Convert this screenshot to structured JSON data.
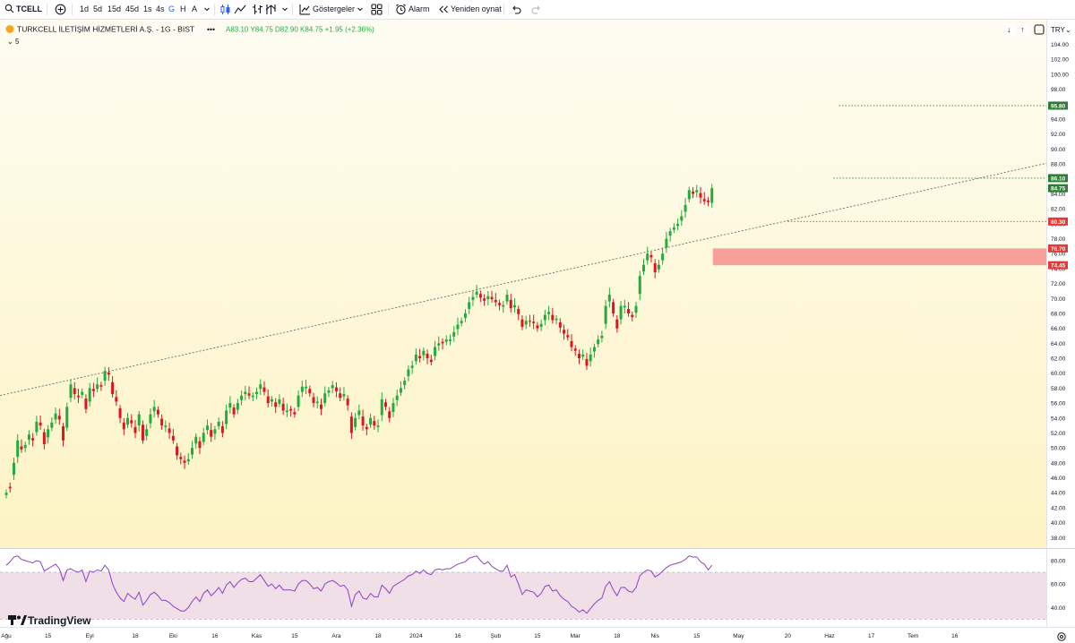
{
  "toolbar": {
    "symbol": "TCELL",
    "intervals": [
      "1d",
      "5d",
      "15d",
      "45d",
      "1s",
      "4s",
      "G",
      "H",
      "A"
    ],
    "active_interval": "G",
    "indicators_label": "Göstergeler",
    "alarm_label": "Alarm",
    "replay_label": "Yeniden oynat"
  },
  "legend": {
    "title": "TURKCELL İLETİŞİM HİZMETLERİ A.Ş. - 1G - BIST",
    "ohlc": "A83.10 Y84.75 D82.90 K84.75 +1.95 (+2.36%)",
    "indicator_count": "5",
    "currency": "TRY"
  },
  "brand": "TradingView",
  "colors": {
    "up": "#22ab3f",
    "down": "#e0141e",
    "bg_top": "#fefcf2",
    "bg_bottom": "#fdf3c4",
    "rsi_line": "#8e3fc6",
    "rsi_band": "#f1dfe8",
    "zone": "#f7a09b",
    "price_tag_green": "#2e7d32",
    "price_tag_red": "#e53935"
  },
  "chart_data": {
    "type": "candlestick",
    "title": "TURKCELL İLETİŞİM HİZMETLERİ A.Ş. - 1G - BIST",
    "y_ticks": [
      38.0,
      40.0,
      42.0,
      44.0,
      46.0,
      48.0,
      50.0,
      52.0,
      54.0,
      56.0,
      58.0,
      60.0,
      62.0,
      64.0,
      66.0,
      68.0,
      70.0,
      72.0,
      74.0,
      76.0,
      78.0,
      80.0,
      82.0,
      84.0,
      86.0,
      88.0,
      90.0,
      92.0,
      94.0,
      96.0,
      98.0,
      100.0,
      102.0,
      104.0
    ],
    "ylim": [
      36.6,
      106.1
    ],
    "x_labels": [
      "Ağu",
      "15",
      "Eyl",
      "18",
      "Eki",
      "16",
      "Kas",
      "15",
      "Ara",
      "18",
      "2024",
      "16",
      "Şub",
      "15",
      "Mar",
      "18",
      "Nis",
      "15",
      "May",
      "20",
      "Haz",
      "17",
      "Tem",
      "16"
    ],
    "x_label_bars": [
      0,
      11,
      22,
      34,
      44,
      55,
      66,
      76,
      87,
      98,
      108,
      119,
      129,
      140,
      150,
      161,
      171,
      182,
      193,
      206,
      217,
      228,
      239,
      250
    ],
    "closes": [
      44.0,
      44.6,
      48.0,
      51.0,
      49.8,
      50.4,
      51.8,
      51.0,
      53.5,
      53.0,
      50.5,
      52.5,
      53.4,
      54.6,
      53.8,
      51.0,
      55.5,
      58.5,
      57.2,
      56.8,
      57.5,
      55.2,
      58.0,
      57.6,
      58.5,
      58.2,
      60.3,
      59.8,
      57.2,
      56.2,
      54.0,
      52.5,
      54.0,
      53.3,
      52.0,
      54.5,
      51.0,
      52.5,
      54.5,
      55.5,
      54.5,
      53.0,
      53.0,
      52.0,
      51.0,
      49.0,
      48.5,
      48.0,
      48.5,
      50.0,
      51.5,
      50.0,
      52.0,
      53.0,
      51.5,
      52.5,
      53.5,
      52.0,
      55.0,
      56.0,
      54.5,
      56.0,
      57.0,
      57.5,
      57.0,
      57.0,
      57.5,
      58.5,
      57.5,
      56.0,
      56.5,
      55.5,
      56.5,
      55.0,
      55.0,
      55.0,
      54.5,
      57.0,
      58.2,
      58.2,
      57.3,
      56.0,
      56.2,
      55.2,
      57.3,
      57.7,
      58.4,
      57.6,
      56.7,
      57.2,
      55.7,
      52.0,
      54.0,
      55.0,
      53.0,
      52.5,
      54.0,
      53.0,
      53.0,
      56.5,
      55.5,
      54.0,
      56.0,
      57.0,
      58.0,
      59.0,
      60.5,
      61.0,
      62.5,
      62.0,
      63.0,
      62.0,
      61.5,
      63.5,
      64.0,
      64.0,
      64.5,
      64.5,
      65.5,
      66.5,
      67.0,
      68.0,
      69.5,
      70.2,
      70.9,
      70.1,
      69.7,
      70.3,
      69.9,
      69.5,
      69.1,
      69.1,
      70.5,
      68.7,
      69.1,
      67.9,
      66.2,
      67.0,
      66.9,
      66.7,
      66.0,
      66.6,
      67.8,
      68.2,
      67.1,
      67.3,
      66.1,
      65.3,
      64.8,
      63.5,
      63.0,
      62.0,
      62.5,
      61.0,
      62.5,
      63.5,
      64.5,
      65.0,
      69.0,
      70.5,
      68.0,
      66.0,
      69.0,
      69.0,
      68.0,
      67.5,
      69.0,
      73.0,
      74.5,
      76.0,
      75.5,
      73.5,
      74.5,
      76.0,
      78.0,
      79.0,
      79.5,
      80.0,
      81.0,
      82.5,
      84.5,
      84.0,
      84.5,
      83.5,
      83.0,
      82.9,
      84.75
    ],
    "spread": [
      0.3,
      -0.2,
      1.6,
      2.2,
      -0.4,
      0.4,
      0.7,
      -0.3,
      1.4,
      -0.4,
      -1.6,
      1.1,
      0.7,
      0.8,
      -0.5,
      -1.9,
      2.8,
      1.8,
      -0.8,
      -0.2,
      0.4,
      -1.4,
      1.8,
      -0.3,
      0.6,
      -0.2,
      1.3,
      -0.3,
      -1.6,
      -0.6,
      -1.3,
      -0.9,
      0.9,
      -0.4,
      -0.8,
      1.5,
      -2.1,
      0.9,
      1.2,
      0.6,
      -0.6,
      -0.9,
      0.2,
      -0.6,
      -0.6,
      -1.2,
      -0.3,
      -0.3,
      0.3,
      0.9,
      0.9,
      -0.9,
      1.2,
      0.6,
      -0.9,
      0.6,
      0.6,
      -0.9,
      1.8,
      0.6,
      -0.9,
      0.9,
      0.6,
      0.3,
      -0.3,
      0.2,
      0.3,
      0.6,
      -0.6,
      -0.9,
      0.3,
      -0.6,
      0.6,
      -0.9,
      0.2,
      -0.2,
      -0.3,
      1.5,
      0.7,
      0.2,
      -0.6,
      -0.8,
      0.2,
      -0.6,
      1.3,
      0.3,
      0.4,
      -0.5,
      -0.6,
      0.3,
      -0.9,
      -2.2,
      1.2,
      0.6,
      -1.2,
      -0.3,
      0.9,
      -0.6,
      0.2,
      2.1,
      -0.6,
      -0.9,
      1.2,
      0.6,
      0.6,
      0.6,
      0.9,
      0.3,
      0.9,
      -0.3,
      0.6,
      -0.6,
      -0.3,
      1.2,
      0.3,
      -0.2,
      0.3,
      0.2,
      0.6,
      0.6,
      0.3,
      0.6,
      0.9,
      0.4,
      0.4,
      -0.5,
      -0.3,
      0.4,
      -0.3,
      -0.3,
      -0.3,
      0.2,
      0.9,
      -1.1,
      0.3,
      -0.7,
      -1.0,
      0.5,
      -0.1,
      -0.2,
      -0.4,
      0.4,
      0.7,
      0.3,
      -0.7,
      0.2,
      -0.7,
      -0.5,
      -0.3,
      -0.8,
      -0.3,
      -0.6,
      0.3,
      -0.9,
      0.9,
      0.6,
      0.6,
      0.3,
      2.4,
      0.9,
      -1.5,
      -1.2,
      1.8,
      0.2,
      -0.6,
      -0.3,
      0.9,
      2.4,
      0.9,
      0.9,
      -0.3,
      -1.2,
      0.6,
      0.9,
      1.2,
      0.6,
      0.3,
      0.3,
      0.6,
      0.9,
      1.2,
      -0.3,
      0.3,
      -0.6,
      -0.3,
      -0.2,
      1.95
    ],
    "overlays": {
      "h_lines": [
        {
          "price": 95.8,
          "style": "dotted",
          "color": "#2e7d32"
        },
        {
          "price": 86.1,
          "style": "dotted",
          "color": "#2e7d32"
        },
        {
          "price": 80.3,
          "style": "dotted",
          "color": "#e53935"
        }
      ],
      "zone": {
        "from_price": 74.45,
        "to_price": 76.7
      },
      "trendline": {
        "start_bar": 0,
        "start_price": 57.2,
        "end_bar": 205,
        "end_price": 80.3
      }
    },
    "price_labels": [
      {
        "text": "95.80",
        "price": 95.8,
        "color": "#2e7d32"
      },
      {
        "text": "86.10",
        "price": 86.1,
        "color": "#2e7d32"
      },
      {
        "text": "84.75",
        "price": 84.75,
        "color": "#2e7d32"
      },
      {
        "text": "80.30",
        "price": 80.3,
        "color": "#e53935"
      },
      {
        "text": "76.70",
        "price": 76.7,
        "color": "#e53935"
      },
      {
        "text": "74.45",
        "price": 74.45,
        "color": "#e53935"
      }
    ],
    "rsi": {
      "y_ticks": [
        40.0,
        60.0,
        80.0
      ],
      "ylim": [
        23.4,
        89.9
      ],
      "band": [
        30,
        70
      ],
      "values": [
        76.0,
        79.0,
        83.0,
        84.0,
        81.0,
        80.0,
        79.0,
        78.0,
        80.0,
        79.0,
        71.0,
        73.0,
        75.0,
        77.0,
        73.0,
        63.0,
        72.0,
        73.0,
        71.0,
        70.0,
        72.0,
        62.0,
        71.0,
        70.0,
        72.0,
        71.0,
        76.0,
        72.0,
        60.0,
        53.0,
        48.0,
        45.0,
        52.0,
        49.0,
        47.0,
        53.0,
        42.0,
        46.0,
        51.0,
        53.0,
        50.0,
        46.0,
        46.0,
        44.0,
        41.0,
        39.0,
        37.0,
        37.0,
        40.0,
        45.0,
        49.0,
        45.0,
        52.0,
        55.0,
        50.0,
        53.0,
        57.0,
        52.0,
        59.0,
        62.0,
        57.0,
        61.0,
        64.0,
        65.0,
        62.0,
        62.0,
        65.0,
        68.0,
        63.0,
        58.0,
        60.0,
        56.0,
        59.0,
        55.0,
        55.0,
        55.0,
        54.0,
        60.0,
        63.0,
        63.0,
        60.0,
        56.0,
        57.0,
        54.0,
        60.0,
        62.0,
        63.0,
        61.0,
        58.0,
        59.0,
        55.0,
        41.0,
        51.0,
        54.0,
        48.0,
        47.0,
        52.0,
        49.0,
        49.0,
        59.0,
        56.0,
        52.0,
        58.0,
        60.0,
        62.0,
        64.0,
        67.0,
        68.0,
        71.0,
        69.0,
        72.0,
        69.0,
        68.0,
        72.0,
        73.0,
        72.0,
        73.0,
        73.0,
        75.0,
        77.0,
        78.0,
        79.0,
        82.0,
        83.0,
        84.0,
        80.0,
        77.0,
        79.0,
        75.0,
        73.0,
        71.0,
        71.0,
        76.0,
        66.0,
        68.0,
        60.0,
        51.0,
        55.0,
        54.0,
        53.0,
        49.0,
        52.0,
        58.0,
        59.0,
        54.0,
        55.0,
        50.0,
        47.0,
        45.0,
        41.0,
        39.0,
        36.0,
        38.0,
        35.0,
        39.0,
        43.0,
        46.0,
        48.0,
        58.0,
        62.0,
        55.0,
        50.0,
        57.0,
        57.0,
        54.0,
        53.0,
        57.0,
        67.0,
        70.0,
        72.0,
        71.0,
        66.0,
        68.0,
        71.0,
        74.0,
        76.0,
        77.0,
        78.0,
        79.0,
        81.0,
        84.0,
        83.0,
        83.0,
        79.0,
        77.0,
        72.0,
        76.0
      ]
    }
  }
}
